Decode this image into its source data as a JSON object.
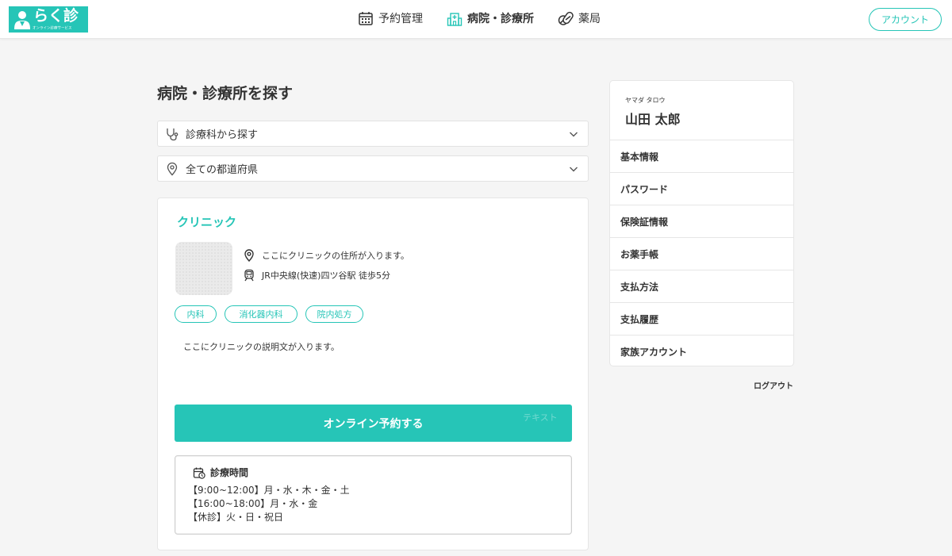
{
  "header": {
    "logo_text": "らく診",
    "logo_subtext": "オンライン診療サービス",
    "nav": [
      {
        "label": "予約管理",
        "icon": "calendar-icon"
      },
      {
        "label": "病院・診療所",
        "icon": "hospital-icon"
      },
      {
        "label": "薬局",
        "icon": "pills-icon"
      }
    ],
    "account_label": "アカウント"
  },
  "main": {
    "title": "病院・診療所を探す",
    "filters": [
      {
        "label": "診療科から探す",
        "icon": "stethoscope-icon"
      },
      {
        "label": "全ての都道府県",
        "icon": "location-pin-icon"
      }
    ]
  },
  "clinic": {
    "name": "クリニック",
    "address": "ここにクリニックの住所が入ります。",
    "access": "JR中央線(快速)四ツ谷駅 徒歩5分",
    "tags": [
      "内科",
      "消化器内科",
      "院内処方"
    ],
    "description": "ここにクリニックの説明文が入ります。",
    "reserve_label": "オンライン予約する",
    "ghost_text": "テキスト",
    "hours": {
      "title": "診療時間",
      "lines": [
        "【9:00~12:00】月・水・木・金・土",
        "【16:00~18:00】月・水・金",
        "【休診】火・日・祝日"
      ]
    }
  },
  "sidebar": {
    "kana": "ヤマダ タロウ",
    "name": "山田 太郎",
    "menu": [
      "基本情報",
      "パスワード",
      "保険証情報",
      "お薬手帳",
      "支払方法",
      "支払履歴",
      "家族アカウント"
    ],
    "logout": "ログアウト"
  },
  "colors": {
    "accent": "#26c5b7",
    "background": "#f5f5f5"
  }
}
